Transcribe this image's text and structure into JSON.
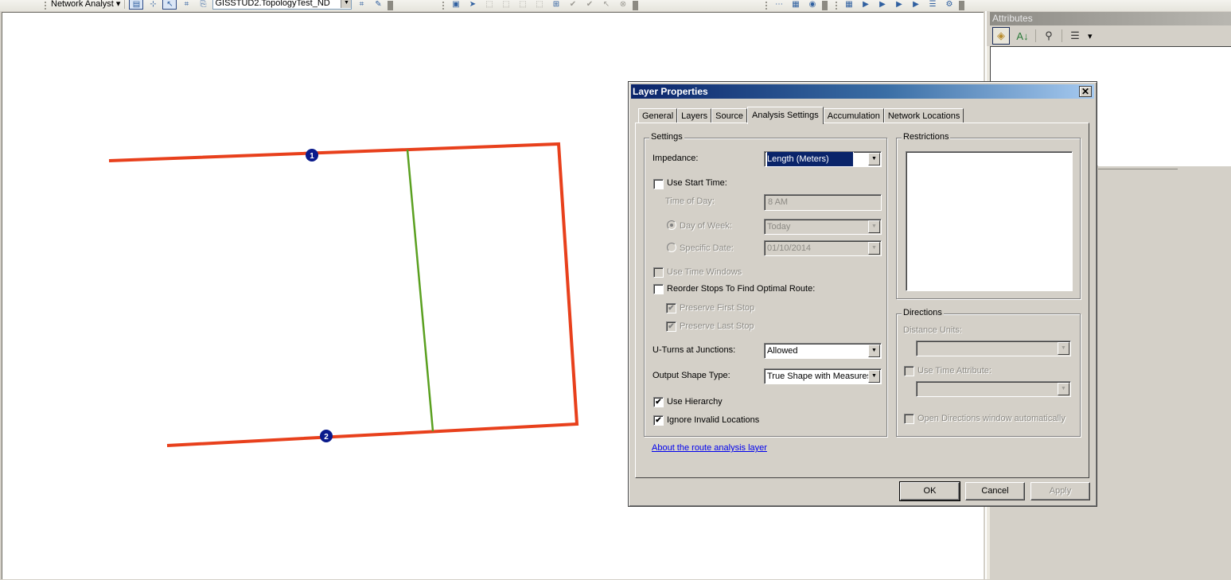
{
  "toolbar": {
    "network_analyst_label": "Network Analyst",
    "network_dataset": "GISSTUD2.TopologyTest_ND",
    "left_buttons": [
      {
        "icon": "network-analyst-window-icon",
        "glyph": "▤",
        "active": true
      },
      {
        "icon": "create-network-location-icon",
        "glyph": "⊹",
        "active": false
      },
      {
        "icon": "select-move-location-icon",
        "glyph": "↖",
        "active": true
      },
      {
        "icon": "build-network-icon",
        "glyph": "⌗",
        "active": false
      },
      {
        "icon": "network-identify-icon",
        "glyph": "⎘",
        "active": false
      }
    ],
    "after_combo_buttons": [
      {
        "icon": "build-grid-icon",
        "glyph": "⌗"
      },
      {
        "icon": "directions-icon",
        "glyph": "✎"
      }
    ],
    "mid_buttons": [
      {
        "icon": "layer-properties-icon",
        "glyph": "▣",
        "dim": false
      },
      {
        "icon": "select-pointer-icon",
        "glyph": "➤",
        "dim": false
      },
      {
        "icon": "edit-vertices-icon",
        "glyph": "⬚",
        "dim": true
      },
      {
        "icon": "reshape-icon",
        "glyph": "⬚",
        "dim": true
      },
      {
        "icon": "cut-polygon-icon",
        "glyph": "⬚",
        "dim": true
      },
      {
        "icon": "split-icon",
        "glyph": "⬚",
        "dim": true
      },
      {
        "icon": "topology-edit-icon",
        "glyph": "⊞",
        "dim": false
      },
      {
        "icon": "validate-icon",
        "glyph": "✔",
        "dim": true
      },
      {
        "icon": "validate-extent-icon",
        "glyph": "✔",
        "dim": true
      },
      {
        "icon": "fix-error-icon",
        "glyph": "↖",
        "dim": true
      },
      {
        "icon": "error-inspector-icon",
        "glyph": "⊗",
        "dim": true
      }
    ],
    "right_buttons_a": [
      {
        "icon": "network-editor-icon",
        "glyph": "⋯"
      },
      {
        "icon": "table-add-icon",
        "glyph": "▦"
      },
      {
        "icon": "globe-icon",
        "glyph": "◉"
      }
    ],
    "right_buttons_b": [
      {
        "icon": "attribute-table-icon",
        "glyph": "▦"
      },
      {
        "icon": "move-forward-icon",
        "glyph": "▶"
      },
      {
        "icon": "move-back-icon",
        "glyph": "▶"
      },
      {
        "icon": "move-icon",
        "glyph": "▶"
      },
      {
        "icon": "edit-route-icon",
        "glyph": "▶"
      },
      {
        "icon": "table-options-icon",
        "glyph": "☰"
      },
      {
        "icon": "settings-icon",
        "glyph": "⚙"
      }
    ]
  },
  "map": {
    "route_color": "#e8401c",
    "edge_color": "#5aa020",
    "stop_color": "#0a1a8c",
    "stops": [
      {
        "label": "1"
      },
      {
        "label": "2"
      }
    ]
  },
  "attributes_pane": {
    "title": "Attributes",
    "buttons": [
      {
        "icon": "attribute-list-icon",
        "glyph": "◈",
        "active": true
      },
      {
        "icon": "sort-az-icon",
        "glyph": "A↓",
        "active": false
      },
      {
        "icon": "show-relationships-icon",
        "glyph": "⚲",
        "active": false
      },
      {
        "icon": "layer-list-icon",
        "glyph": "☰",
        "active": false
      }
    ]
  },
  "dialog": {
    "title": "Layer Properties",
    "close_glyph": "✕",
    "tabs": [
      {
        "label": "General",
        "selected": false
      },
      {
        "label": "Layers",
        "selected": false
      },
      {
        "label": "Source",
        "selected": false
      },
      {
        "label": "Analysis Settings",
        "selected": true
      },
      {
        "label": "Accumulation",
        "selected": false
      },
      {
        "label": "Network Locations",
        "selected": false
      }
    ],
    "settings": {
      "group_label": "Settings",
      "impedance_label": "Impedance:",
      "impedance_value": "Length (Meters)",
      "use_start_time_label": "Use Start Time:",
      "use_start_time_checked": false,
      "time_of_day_label": "Time of Day:",
      "time_of_day_value": "8 AM",
      "day_of_week_label": "Day of Week:",
      "day_of_week_selected": true,
      "day_of_week_value": "Today",
      "specific_date_label": "Specific Date:",
      "specific_date_selected": false,
      "specific_date_value": "01/10/2014",
      "use_time_windows_label": "Use Time Windows",
      "use_time_windows_checked": false,
      "reorder_stops_label": "Reorder Stops To Find Optimal Route:",
      "reorder_stops_checked": false,
      "preserve_first_label": "Preserve First Stop",
      "preserve_first_checked": true,
      "preserve_last_label": "Preserve Last Stop",
      "preserve_last_checked": true,
      "uturns_label": "U-Turns at Junctions:",
      "uturns_value": "Allowed",
      "output_shape_label": "Output Shape Type:",
      "output_shape_value": "True Shape with Measures",
      "use_hierarchy_label": "Use Hierarchy",
      "use_hierarchy_checked": true,
      "ignore_invalid_label": "Ignore Invalid Locations",
      "ignore_invalid_checked": true
    },
    "restrictions": {
      "group_label": "Restrictions",
      "items": []
    },
    "directions": {
      "group_label": "Directions",
      "distance_units_label": "Distance Units:",
      "distance_units_value": "",
      "use_time_attribute_label": "Use Time Attribute:",
      "use_time_attribute_checked": false,
      "time_attribute_value": "",
      "open_directions_label": "Open Directions window automatically",
      "open_directions_checked": false
    },
    "about_link": "About the route analysis layer",
    "buttons": {
      "ok": "OK",
      "cancel": "Cancel",
      "apply": "Apply"
    },
    "check_glyph": "✔",
    "arrow_glyph": "▼"
  }
}
